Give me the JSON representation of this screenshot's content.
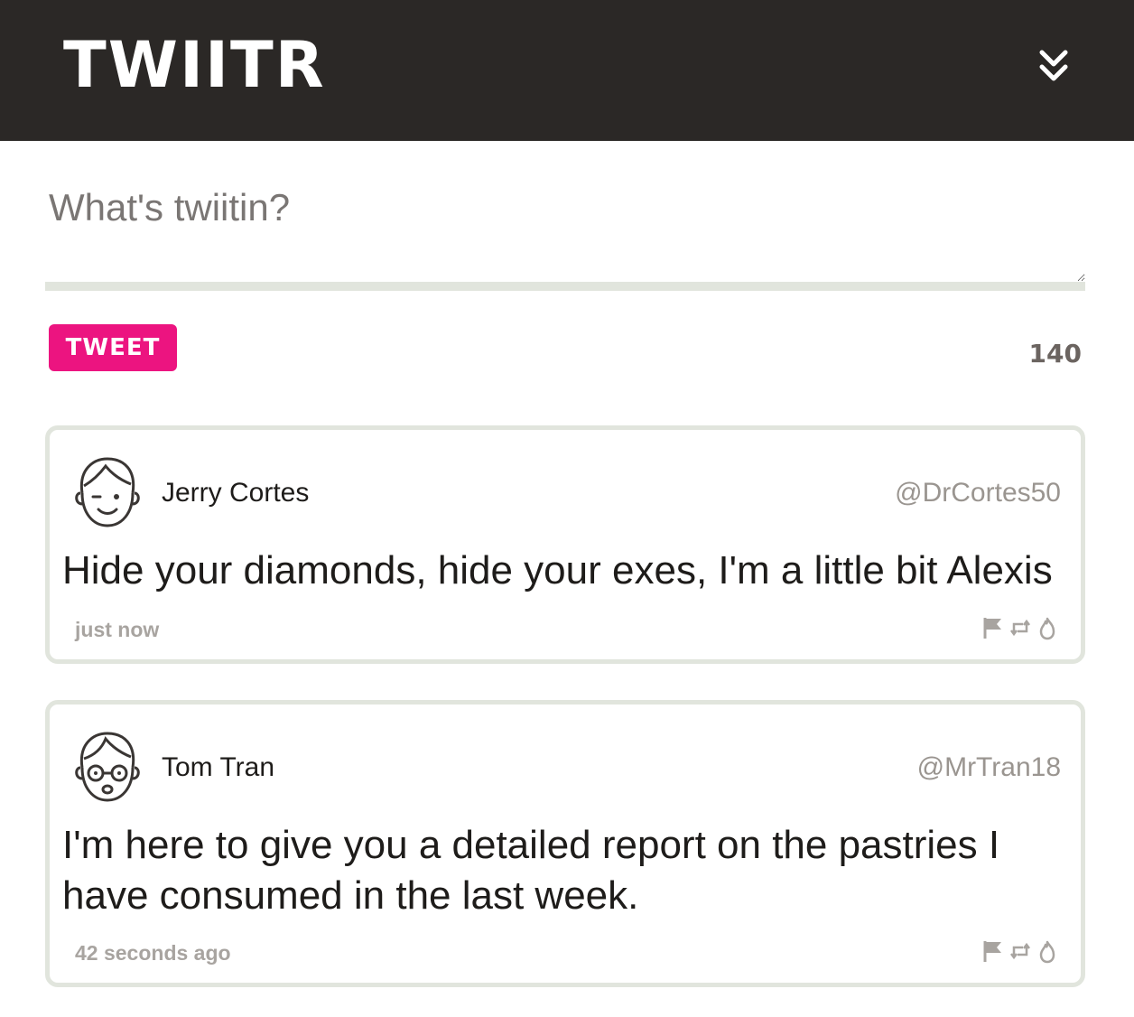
{
  "app": {
    "title": "TWIITR"
  },
  "compose": {
    "placeholder": "What's twiitin?",
    "button_label": "TWEET",
    "char_count": "140"
  },
  "tweets": [
    {
      "name": "Jerry Cortes",
      "handle": "@DrCortes50",
      "text": "Hide your diamonds, hide your exes, I'm a little bit Alexis",
      "time": "just now",
      "avatar_icon": "winking-face-avatar-icon"
    },
    {
      "name": "Tom Tran",
      "handle": "@MrTran18",
      "text": "I'm here to give you a detailed report on the pastries I have consumed in the last week.",
      "time": "42 seconds ago",
      "avatar_icon": "glasses-face-avatar-icon"
    }
  ],
  "icons": {
    "menu": "double-chevron-down-icon",
    "flag": "flag-icon",
    "retweet": "retweet-icon",
    "like": "flame-icon"
  },
  "colors": {
    "header_bg": "#2b2826",
    "accent": "#ec1480",
    "border": "#e1e5dd",
    "muted": "#a8a4a0"
  }
}
